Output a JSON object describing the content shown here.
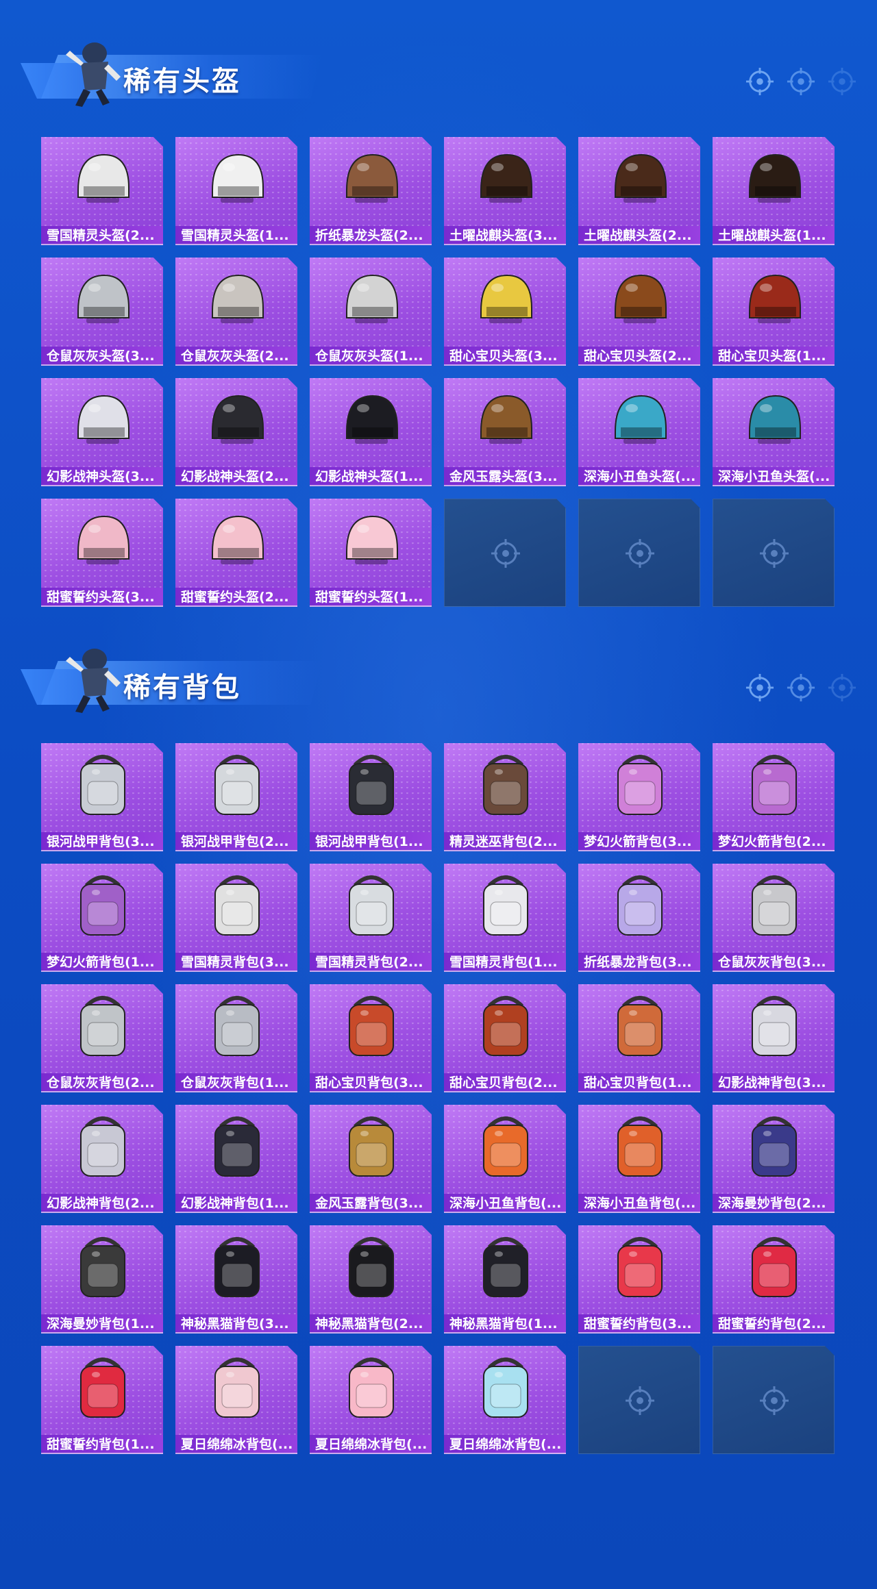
{
  "colors": {
    "background": "#0d50c8",
    "card_fill": "#a95be8",
    "card_label": "#7a2ad0",
    "empty_slot": "#1f4a8c",
    "title_text": "#ffffff"
  },
  "sections": [
    {
      "title": "稀有头盔",
      "items": [
        {
          "label": "雪国精灵头盔(2...",
          "art": "white-bird-helmet-icon",
          "color": "#e8e8e8"
        },
        {
          "label": "雪国精灵头盔(1...",
          "art": "white-bird-helmet-icon",
          "color": "#f0f0f0"
        },
        {
          "label": "折纸暴龙头盔(2...",
          "art": "dino-helmet-icon",
          "color": "#8b5a3c"
        },
        {
          "label": "土曜战麒头盔(3...",
          "art": "qilin-helmet-icon",
          "color": "#3a2418"
        },
        {
          "label": "土曜战麒头盔(2...",
          "art": "qilin-helmet-icon",
          "color": "#4a2a1a"
        },
        {
          "label": "土曜战麒头盔(1...",
          "art": "qilin-helmet-icon",
          "color": "#2a1c14"
        },
        {
          "label": "仓鼠灰灰头盔(3...",
          "art": "hamster-helmet-icon",
          "color": "#bfc3c8"
        },
        {
          "label": "仓鼠灰灰头盔(2...",
          "art": "hamster-helmet-icon",
          "color": "#c9c4bf"
        },
        {
          "label": "仓鼠灰灰头盔(1...",
          "art": "hamster-helmet-icon",
          "color": "#d3d3d3"
        },
        {
          "label": "甜心宝贝头盔(3...",
          "art": "dessert-helmet-icon",
          "color": "#e8c840"
        },
        {
          "label": "甜心宝贝头盔(2...",
          "art": "dessert-helmet-icon",
          "color": "#8a4a1c"
        },
        {
          "label": "甜心宝贝头盔(1...",
          "art": "dessert-helmet-icon",
          "color": "#9a2a1a"
        },
        {
          "label": "幻影战神头盔(3...",
          "art": "phantom-helmet-icon",
          "color": "#e0e0e8"
        },
        {
          "label": "幻影战神头盔(2...",
          "art": "phantom-helmet-icon",
          "color": "#2a2a30"
        },
        {
          "label": "幻影战神头盔(1...",
          "art": "phantom-helmet-icon",
          "color": "#1c1c22"
        },
        {
          "label": "金风玉露头盔(3...",
          "art": "golden-helmet-icon",
          "color": "#8a5a2a"
        },
        {
          "label": "深海小丑鱼头盔(...",
          "art": "clownfish-helmet-icon",
          "color": "#3aa8c8"
        },
        {
          "label": "深海小丑鱼头盔(...",
          "art": "clownfish-helmet-icon",
          "color": "#2a8ca8"
        },
        {
          "label": "甜蜜誓约头盔(3...",
          "art": "pink-helmet-icon",
          "color": "#f0b8c8"
        },
        {
          "label": "甜蜜誓约头盔(2...",
          "art": "pink-helmet-icon",
          "color": "#f4c0cc"
        },
        {
          "label": "甜蜜誓约头盔(1...",
          "art": "pink-helmet-icon",
          "color": "#f8c8d4"
        },
        {
          "label": "",
          "art": "empty-slot-icon",
          "empty": true
        },
        {
          "label": "",
          "art": "empty-slot-icon",
          "empty": true
        },
        {
          "label": "",
          "art": "empty-slot-icon",
          "empty": true
        }
      ]
    },
    {
      "title": "稀有背包",
      "items": [
        {
          "label": "银河战甲背包(3...",
          "art": "galaxy-backpack-icon",
          "color": "#c8ccd4"
        },
        {
          "label": "银河战甲背包(2...",
          "art": "galaxy-backpack-icon",
          "color": "#d4d8dc"
        },
        {
          "label": "银河战甲背包(1...",
          "art": "galaxy-backpack-icon",
          "color": "#2a2c34"
        },
        {
          "label": "精灵迷巫背包(2...",
          "art": "witch-backpack-icon",
          "color": "#6a4a3a"
        },
        {
          "label": "梦幻火箭背包(3...",
          "art": "rocket-backpack-icon",
          "color": "#d080d8"
        },
        {
          "label": "梦幻火箭背包(2...",
          "art": "rocket-backpack-icon",
          "color": "#b86ad0"
        },
        {
          "label": "梦幻火箭背包(1...",
          "art": "rocket-backpack-icon",
          "color": "#a060c8"
        },
        {
          "label": "雪国精灵背包(3...",
          "art": "snowman-backpack-icon",
          "color": "#e0e0e0"
        },
        {
          "label": "雪国精灵背包(2...",
          "art": "snowman-backpack-icon",
          "color": "#d8dce0"
        },
        {
          "label": "雪国精灵背包(1...",
          "art": "snowman-backpack-icon",
          "color": "#e8e8ec"
        },
        {
          "label": "折纸暴龙背包(3...",
          "art": "dino-backpack-icon",
          "color": "#b8a8e8"
        },
        {
          "label": "仓鼠灰灰背包(3...",
          "art": "hamster-backpack-icon",
          "color": "#c8c8cc"
        },
        {
          "label": "仓鼠灰灰背包(2...",
          "art": "hamster-backpack-icon",
          "color": "#c0c4c8"
        },
        {
          "label": "仓鼠灰灰背包(1...",
          "art": "hamster-backpack-icon",
          "color": "#b8bcc4"
        },
        {
          "label": "甜心宝贝背包(3...",
          "art": "cupcake-backpack-icon",
          "color": "#c84a2a"
        },
        {
          "label": "甜心宝贝背包(2...",
          "art": "cupcake-backpack-icon",
          "color": "#b04020"
        },
        {
          "label": "甜心宝贝背包(1...",
          "art": "cupcake-backpack-icon",
          "color": "#d06a3a"
        },
        {
          "label": "幻影战神背包(3...",
          "art": "phantom-backpack-icon",
          "color": "#d8d8e0"
        },
        {
          "label": "幻影战神背包(2...",
          "art": "phantom-backpack-icon",
          "color": "#c8c8d4"
        },
        {
          "label": "幻影战神背包(1...",
          "art": "phantom-backpack-icon",
          "color": "#2a2a38"
        },
        {
          "label": "金风玉露背包(3...",
          "art": "golden-backpack-icon",
          "color": "#b88a3a"
        },
        {
          "label": "深海小丑鱼背包(...",
          "art": "clownfish-backpack-icon",
          "color": "#e86a2a"
        },
        {
          "label": "深海小丑鱼背包(...",
          "art": "clownfish-backpack-icon",
          "color": "#e0602a"
        },
        {
          "label": "深海曼妙背包(2...",
          "art": "deepsea-backpack-icon",
          "color": "#3a3a8a"
        },
        {
          "label": "深海曼妙背包(1...",
          "art": "deepsea-backpack-icon",
          "color": "#3a3a3a"
        },
        {
          "label": "神秘黑猫背包(3...",
          "art": "cat-backpack-icon",
          "color": "#1c1c24"
        },
        {
          "label": "神秘黑猫背包(2...",
          "art": "cat-backpack-icon",
          "color": "#1a1a1e"
        },
        {
          "label": "神秘黑猫背包(1...",
          "art": "cat-backpack-icon",
          "color": "#202028"
        },
        {
          "label": "甜蜜誓约背包(3...",
          "art": "bow-backpack-icon",
          "color": "#e8384a"
        },
        {
          "label": "甜蜜誓约背包(2...",
          "art": "bow-backpack-icon",
          "color": "#e02a44"
        },
        {
          "label": "甜蜜誓约背包(1...",
          "art": "heart-backpack-icon",
          "color": "#e02a40"
        },
        {
          "label": "夏日绵绵冰背包(...",
          "art": "icecream-backpack-icon",
          "color": "#f0c8d0"
        },
        {
          "label": "夏日绵绵冰背包(...",
          "art": "icecream-backpack-icon",
          "color": "#f8b8c8"
        },
        {
          "label": "夏日绵绵冰背包(...",
          "art": "icecream-backpack-icon",
          "color": "#a8e0f0"
        },
        {
          "label": "",
          "art": "empty-slot-icon",
          "empty": true
        },
        {
          "label": "",
          "art": "empty-slot-icon",
          "empty": true
        }
      ]
    }
  ]
}
